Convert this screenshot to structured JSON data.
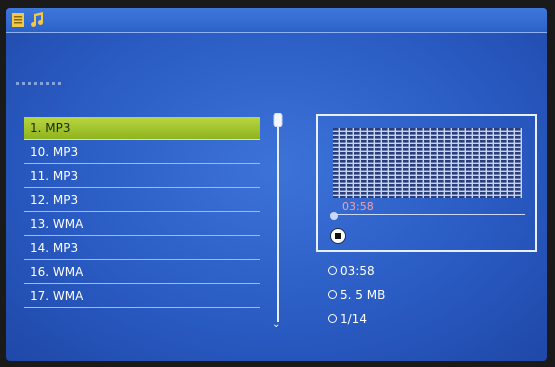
{
  "colors": {
    "background": "#2a5cc4",
    "selected": "#a6c830",
    "text": "#ffffff",
    "timeAccent": "#f0a0b0"
  },
  "topbar": {
    "icons": [
      "list-icon",
      "music-note-icon"
    ]
  },
  "playlist": {
    "items": [
      "1. MP3",
      "10. MP3",
      "11. MP3",
      "12. MP3",
      "13. WMA",
      "14. MP3",
      "16. WMA",
      "17. WMA"
    ],
    "selectedIndex": 0
  },
  "player": {
    "elapsed": "03:58",
    "progress": 0.0
  },
  "info": {
    "duration": "03:58",
    "size": "5. 5 MB",
    "track": "1/14"
  }
}
